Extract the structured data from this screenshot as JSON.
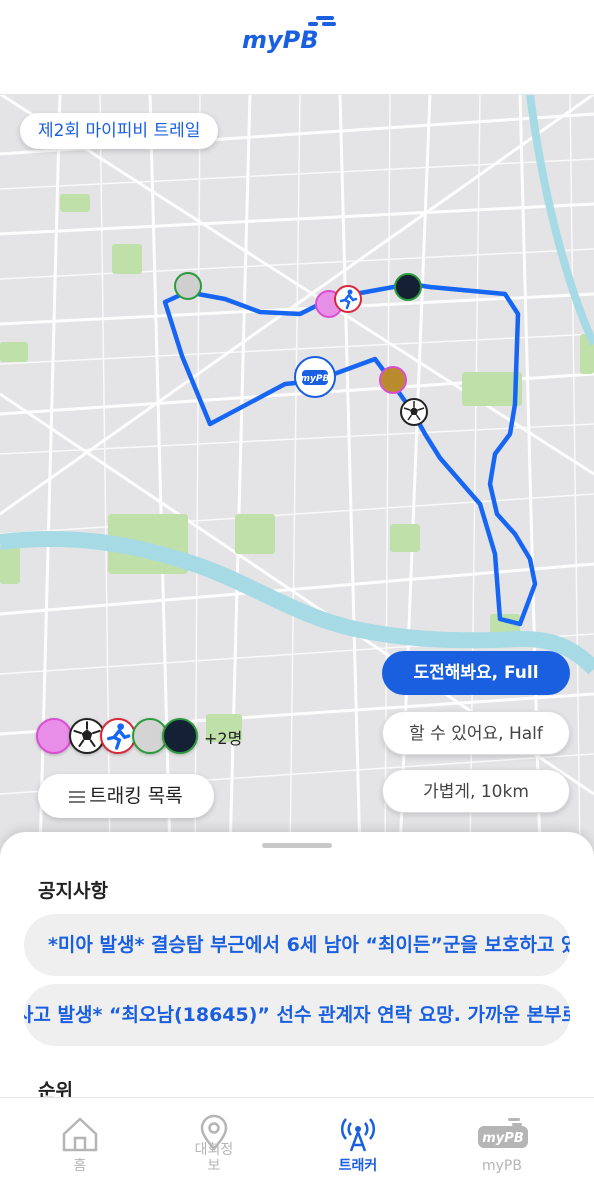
{
  "app": {
    "logo_text": "myPB"
  },
  "event": {
    "title": "제2회 마이피비 트레일"
  },
  "map": {
    "pin_logo_text": "myPB"
  },
  "modes": {
    "full": "도전해봐요, Full",
    "half": "할 수 있어요, Half",
    "short": "가볍게, 10km"
  },
  "runners": {
    "more": "+2명"
  },
  "tracking_list": {
    "label": "트래킹 목록"
  },
  "notices": {
    "title": "공지사항",
    "items": [
      "*미아 발생* 결승탑 부근에서 6세 남아 “최이든”군을 보호하고 있습니다.",
      "*사고 발생* “최오남(18645)” 선수 관계자 연락 요망. 가까운 본부로 와주세요."
    ]
  },
  "ranking": {
    "title": "순위"
  },
  "tabs": [
    {
      "label": "홈",
      "icon": "home-icon",
      "active": false
    },
    {
      "label": "대회정보",
      "icon": "location-pin-icon",
      "active": false
    },
    {
      "label": "트래커",
      "icon": "antenna-icon",
      "active": true
    },
    {
      "label": "myPB",
      "icon": "mypb-logo-icon",
      "active": false
    }
  ],
  "colors": {
    "accent": "#1a5fe0",
    "map_bg": "#e4e4e6",
    "water": "#a6dbe6",
    "park": "#bfe0a8"
  }
}
